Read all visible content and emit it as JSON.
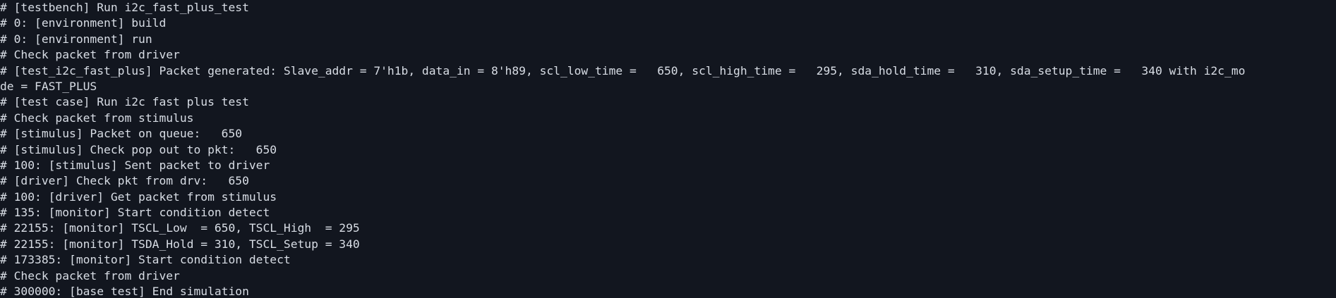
{
  "console": {
    "lines": [
      "# [testbench] Run i2c_fast_plus_test",
      "# 0: [environment] build",
      "# 0: [environment] run",
      "# Check packet from driver",
      "# [test_i2c_fast_plus] Packet generated: Slave_addr = 7'h1b, data_in = 8'h89, scl_low_time =   650, scl_high_time =   295, sda_hold_time =   310, sda_setup_time =   340 with i2c_mo",
      "de = FAST_PLUS",
      "# [test case] Run i2c fast plus test",
      "# Check packet from stimulus",
      "# [stimulus] Packet on queue:   650",
      "# [stimulus] Check pop out to pkt:   650",
      "# 100: [stimulus] Sent packet to driver",
      "# [driver] Check pkt from drv:   650",
      "# 100: [driver] Get packet from stimulus",
      "# 135: [monitor] Start condition detect",
      "# 22155: [monitor] TSCL_Low  = 650, TSCL_High  = 295",
      "# 22155: [monitor] TSDA_Hold = 310, TSCL_Setup = 340",
      "# 173385: [monitor] Start condition detect",
      "# Check packet from driver",
      "# 300000: [base test] End simulation"
    ]
  }
}
